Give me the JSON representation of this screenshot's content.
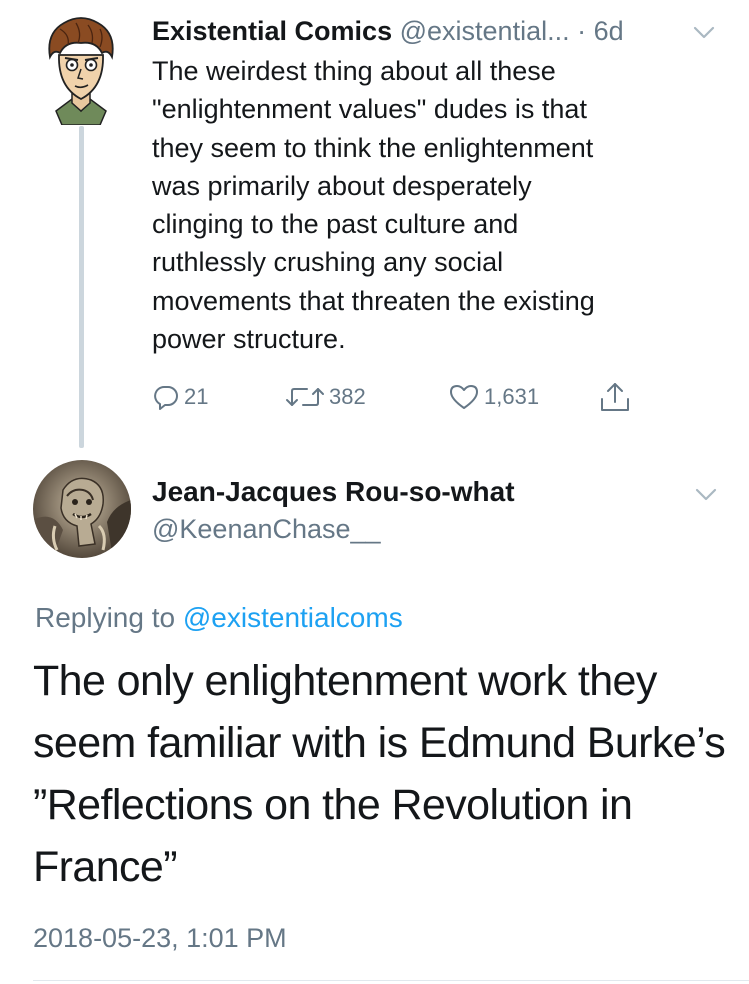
{
  "tweet1": {
    "display_name": "Existential Comics",
    "handle": "@existential...",
    "time": " · 6d",
    "lines": [
      "The weirdest thing about all these",
      "\"enlightenment values\" dudes is that",
      "they seem to think the enlightenment",
      "was primarily about desperately",
      "clinging to the past culture and",
      "ruthlessly crushing any social",
      "movements that threaten the existing",
      "power structure."
    ],
    "actions": {
      "replies": "21",
      "retweets": "382",
      "likes": "1,631"
    }
  },
  "tweet2": {
    "display_name": "Jean-Jacques Rou-so-what",
    "handle": "@KeenanChase__",
    "replying_prefix": "Replying to ",
    "replying_to": "@existentialcoms",
    "lines": [
      "The only enlightenment work they",
      "seem familiar with is Edmund Burke’s",
      "”Reflections on the Revolution in",
      "France”"
    ],
    "timestamp": "2018-05-23, 1:01 PM"
  },
  "colors": {
    "text": "#14171a",
    "secondary": "#657786",
    "link": "#1da1f2",
    "thread_line": "#ccd6dd"
  },
  "icons": [
    "avatar-cartoon",
    "avatar-gargoyle",
    "chevron-down-icon",
    "reply-icon",
    "retweet-icon",
    "heart-icon",
    "share-icon"
  ]
}
